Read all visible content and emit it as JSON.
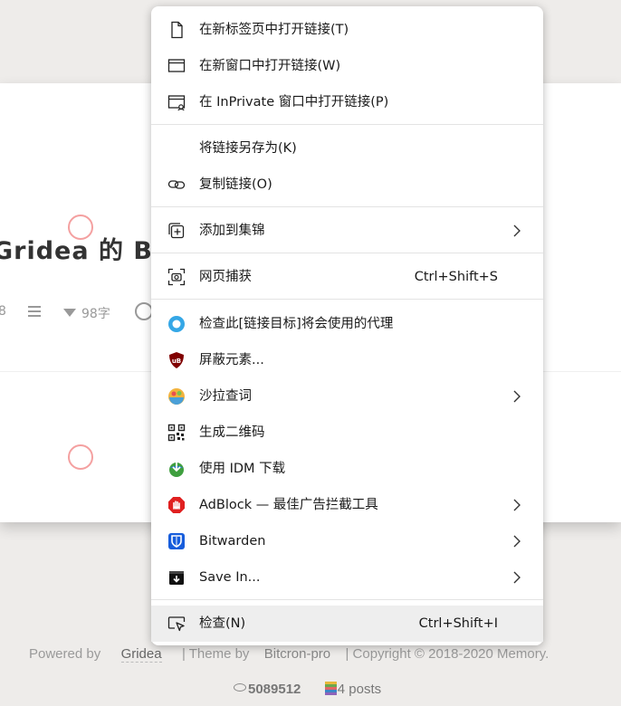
{
  "page": {
    "post_title": "Gridea 的 Bi",
    "meta_num": "8",
    "meta_words": "98字"
  },
  "footer": {
    "powered_by": "Powered by",
    "gridea": "Gridea",
    "theme_by": "| Theme by",
    "bitcron": "Bitcron-pro",
    "copyright": "| Copyright © 2018-2020 Memory.",
    "views": "5089512",
    "posts": "4 posts"
  },
  "context_menu": {
    "items": [
      {
        "label": "在新标签页中打开链接(T)",
        "icon": "new-tab-icon"
      },
      {
        "label": "在新窗口中打开链接(W)",
        "icon": "new-window-icon"
      },
      {
        "label": "在 InPrivate 窗口中打开链接(P)",
        "icon": "inprivate-window-icon"
      },
      {
        "label": "将链接另存为(K)",
        "icon": ""
      },
      {
        "label": "复制链接(O)",
        "icon": "link-icon"
      },
      {
        "label": "添加到集锦",
        "icon": "collections-icon",
        "submenu": true
      },
      {
        "label": "网页捕获",
        "icon": "web-capture-icon",
        "shortcut": "Ctrl+Shift+S"
      },
      {
        "label": "检查此[链接目标]将会使用的代理",
        "icon": "proxy-icon"
      },
      {
        "label": "屏蔽元素...",
        "icon": "ublock-icon"
      },
      {
        "label": "沙拉查词",
        "icon": "saladict-icon",
        "submenu": true
      },
      {
        "label": "生成二维码",
        "icon": "qrcode-icon"
      },
      {
        "label": "使用 IDM 下载",
        "icon": "idm-icon"
      },
      {
        "label": "AdBlock — 最佳广告拦截工具",
        "icon": "adblock-icon",
        "submenu": true
      },
      {
        "label": "Bitwarden",
        "icon": "bitwarden-icon",
        "submenu": true
      },
      {
        "label": "Save In...",
        "icon": "save-in-icon",
        "submenu": true
      },
      {
        "label": "检查(N)",
        "icon": "inspect-icon",
        "shortcut": "Ctrl+Shift+I",
        "active": true
      }
    ]
  },
  "colors": {
    "menu_background": "#ffffff",
    "active_item": "#eeeeee",
    "separator": "#e3e3e3",
    "click_ring": "#f4a0a0"
  }
}
